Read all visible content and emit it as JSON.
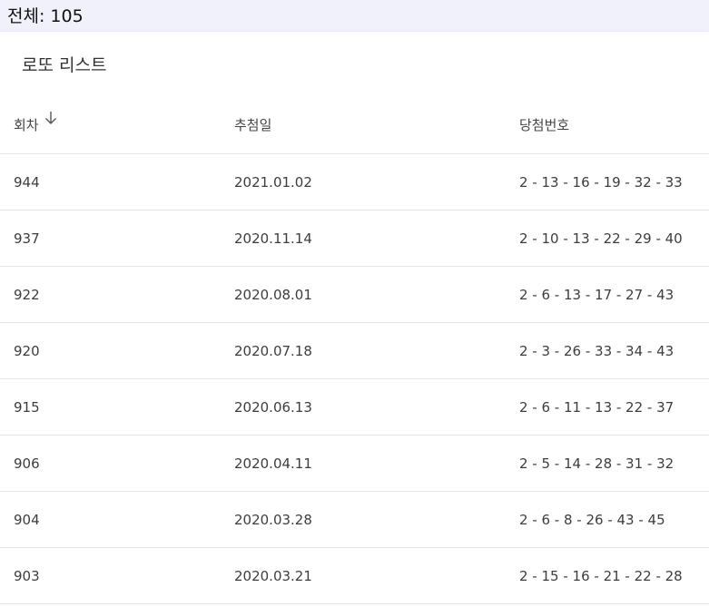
{
  "total": {
    "text": "전체: 105"
  },
  "card": {
    "title": "로또 리스트"
  },
  "table": {
    "headers": {
      "round": "회차",
      "date": "추첨일",
      "numbers": "당첨번호"
    },
    "sort_icon": "arrow-down-icon",
    "rows": [
      {
        "round": "944",
        "date": "2021.01.02",
        "numbers": "2 - 13 - 16 - 19 - 32 - 33"
      },
      {
        "round": "937",
        "date": "2020.11.14",
        "numbers": "2 - 10 - 13 - 22 - 29 - 40"
      },
      {
        "round": "922",
        "date": "2020.08.01",
        "numbers": "2 - 6 - 13 - 17 - 27 - 43"
      },
      {
        "round": "920",
        "date": "2020.07.18",
        "numbers": "2 - 3 - 26 - 33 - 34 - 43"
      },
      {
        "round": "915",
        "date": "2020.06.13",
        "numbers": "2 - 6 - 11 - 13 - 22 - 37"
      },
      {
        "round": "906",
        "date": "2020.04.11",
        "numbers": "2 - 5 - 14 - 28 - 31 - 32"
      },
      {
        "round": "904",
        "date": "2020.03.28",
        "numbers": "2 - 6 - 8 - 26 - 43 - 45"
      },
      {
        "round": "903",
        "date": "2020.03.21",
        "numbers": "2 - 15 - 16 - 21 - 22 - 28"
      }
    ]
  }
}
